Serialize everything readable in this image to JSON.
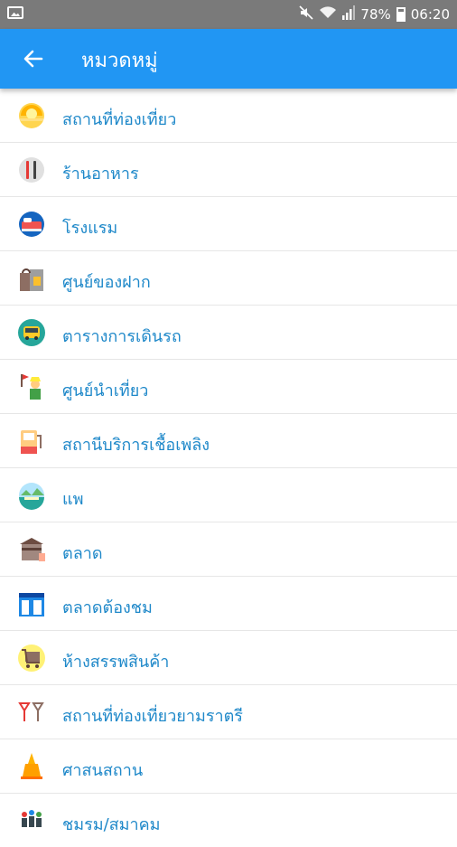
{
  "status_bar": {
    "battery": "78%",
    "time": "06:20"
  },
  "app_bar": {
    "title": "หมวดหมู่"
  },
  "categories": [
    {
      "label": "สถานที่ท่องเที่ยว",
      "icon": "sun-icon"
    },
    {
      "label": "ร้านอาหาร",
      "icon": "fork-knife-icon"
    },
    {
      "label": "โรงแรม",
      "icon": "bed-icon"
    },
    {
      "label": "ศูนย์ของฝาก",
      "icon": "gift-bag-icon"
    },
    {
      "label": "ตารางการเดินรถ",
      "icon": "bus-icon"
    },
    {
      "label": "ศูนย์นำเที่ยว",
      "icon": "tour-guide-icon"
    },
    {
      "label": "สถานีบริการเชื้อเพลิง",
      "icon": "fuel-pump-icon"
    },
    {
      "label": "แพ",
      "icon": "raft-icon"
    },
    {
      "label": "ตลาด",
      "icon": "market-icon"
    },
    {
      "label": "ตลาดต้องชม",
      "icon": "shop-icon"
    },
    {
      "label": "ห้างสรรพสินค้า",
      "icon": "shopping-cart-icon"
    },
    {
      "label": "สถานที่ท่องเที่ยวยามราตรี",
      "icon": "cocktail-glass-icon"
    },
    {
      "label": "ศาสนสถาน",
      "icon": "temple-icon"
    },
    {
      "label": "ชมรม/สมาคม",
      "icon": "people-icon"
    }
  ]
}
